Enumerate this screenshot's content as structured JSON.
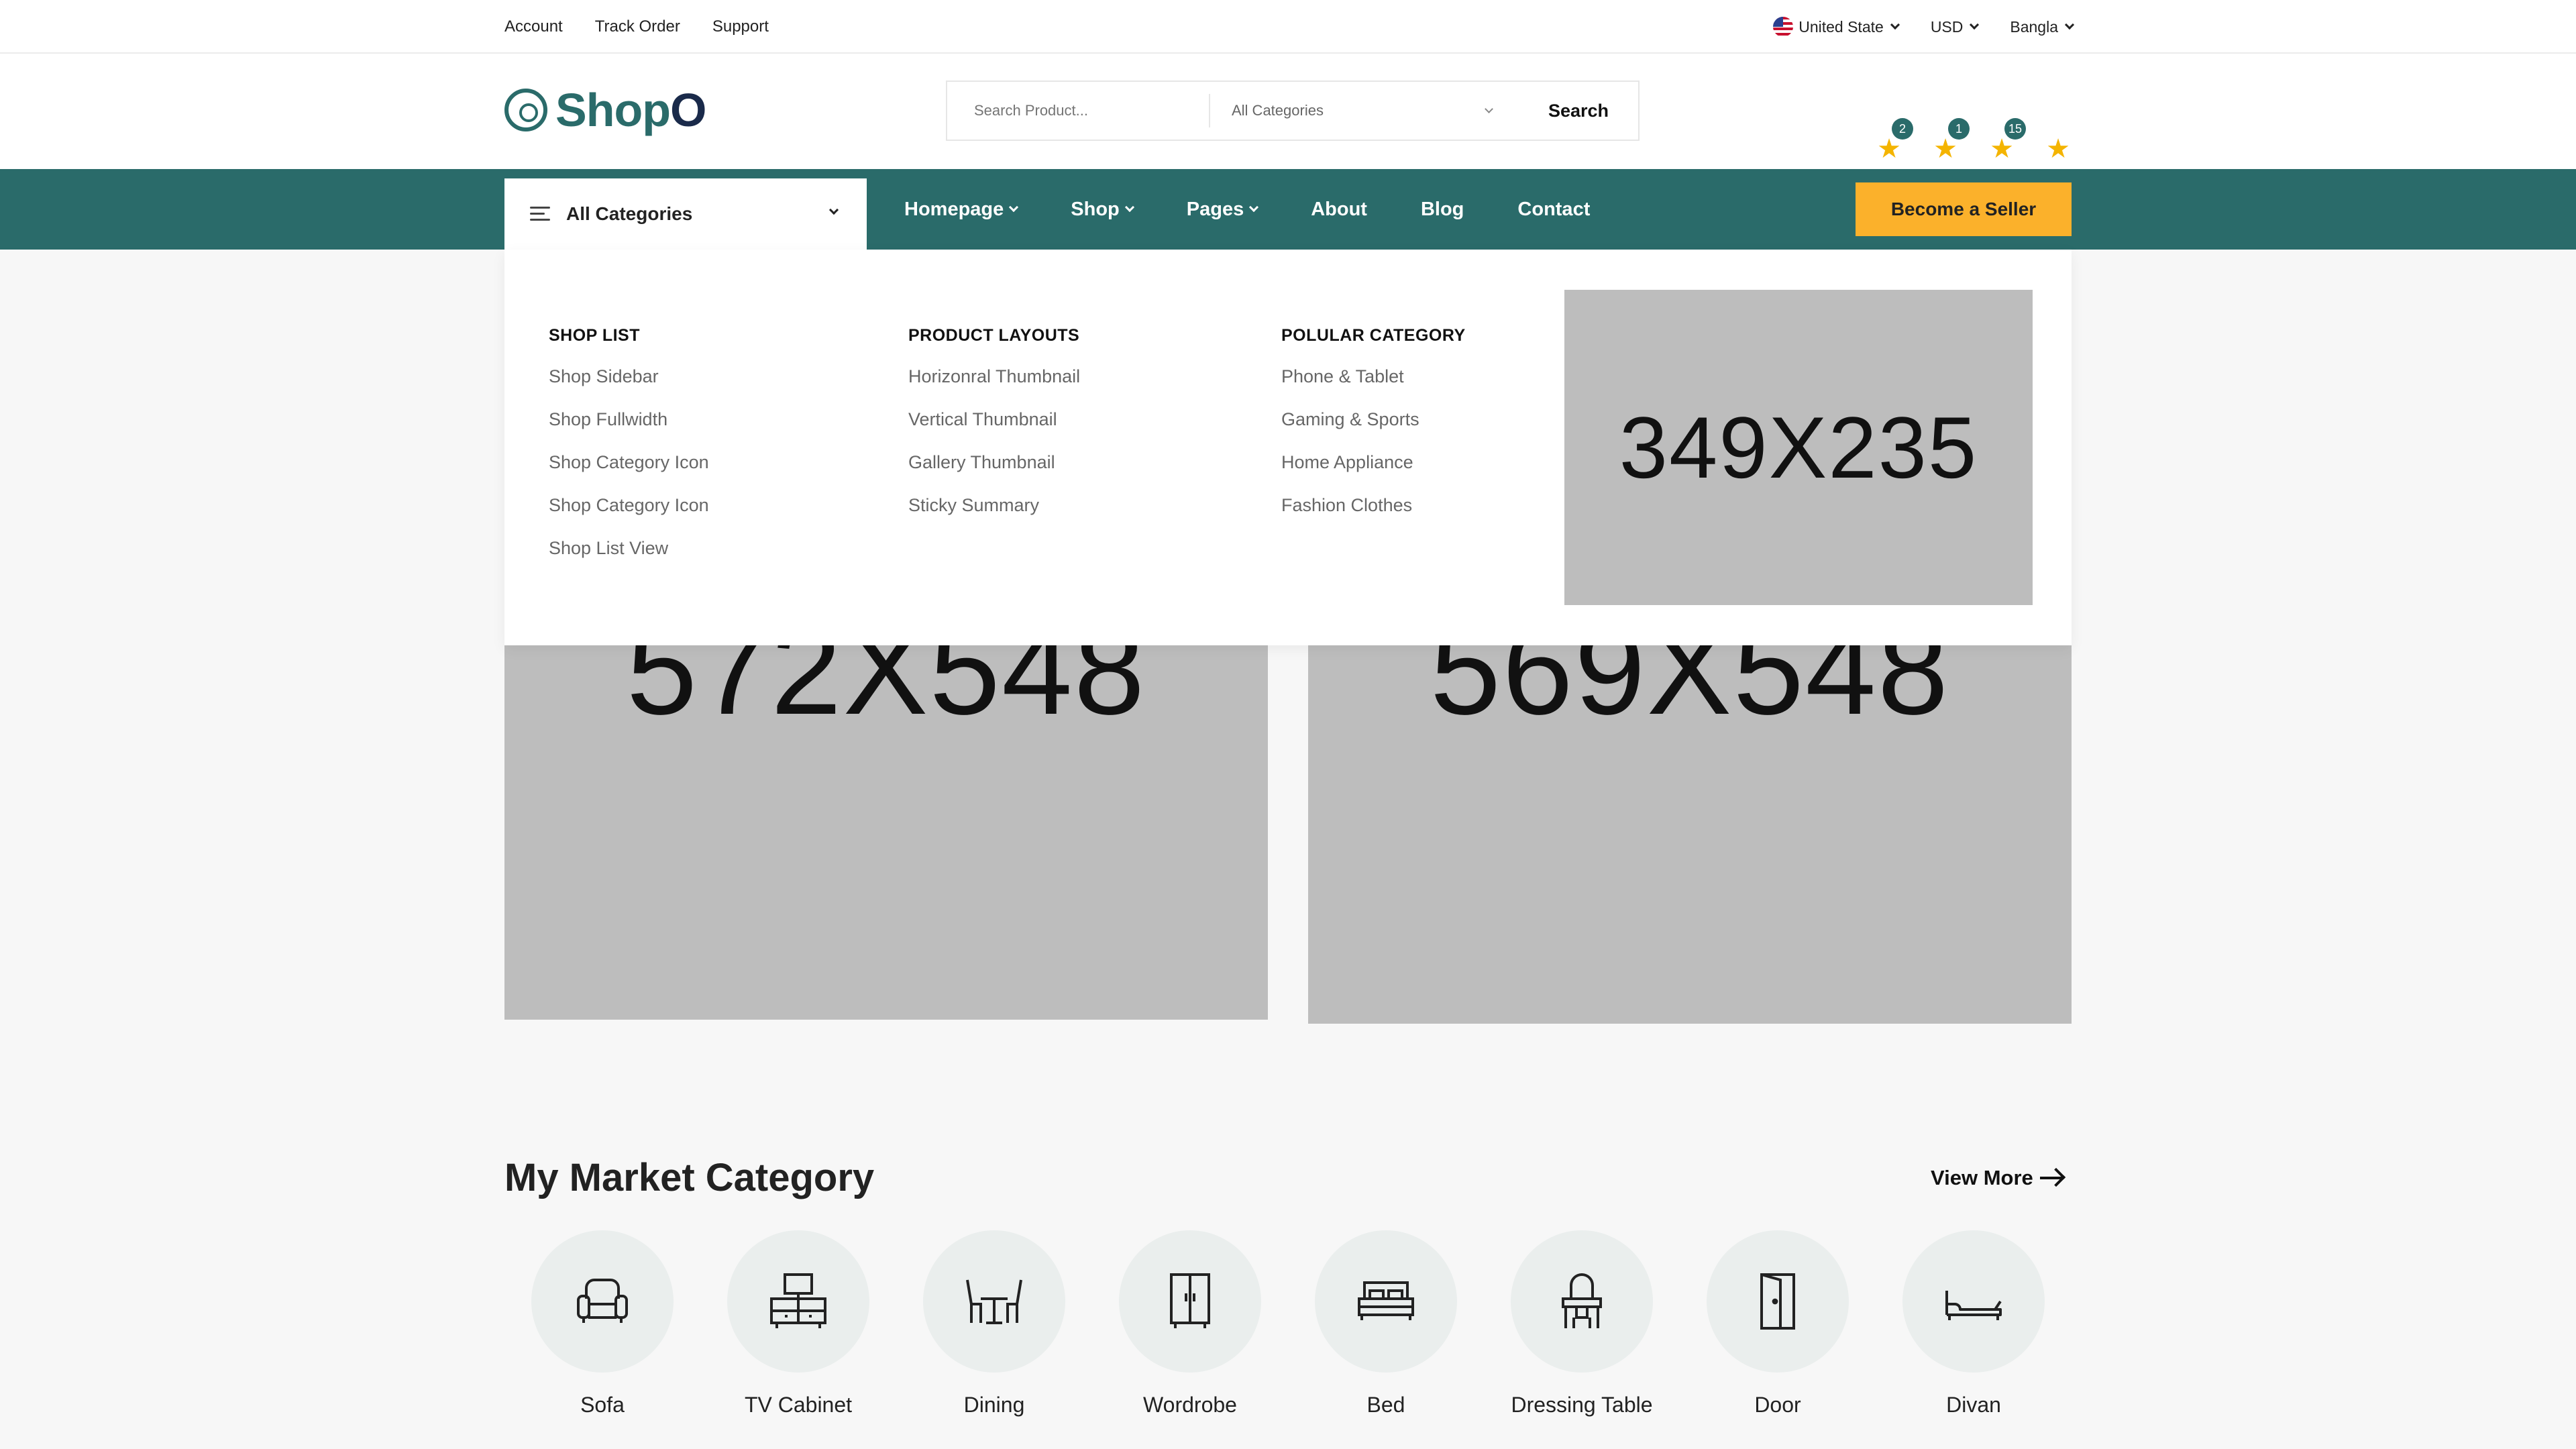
{
  "topbar": {
    "links": [
      "Account",
      "Track Order",
      "Support"
    ],
    "country": "United State",
    "currency": "USD",
    "language": "Bangla"
  },
  "logo": {
    "text": "Shop",
    "accent": "O"
  },
  "search": {
    "placeholder": "Search Product...",
    "category": "All Categories",
    "button": "Search"
  },
  "header_icons": [
    {
      "icon": "star-icon",
      "count": "2"
    },
    {
      "icon": "star-icon",
      "count": "1"
    },
    {
      "icon": "star-icon",
      "count": "15"
    },
    {
      "icon": "star-icon",
      "count": ""
    }
  ],
  "nav": {
    "all_categories": "All Categories",
    "items": [
      {
        "label": "Homepage",
        "dropdown": true
      },
      {
        "label": "Shop",
        "dropdown": true
      },
      {
        "label": "Pages",
        "dropdown": true
      },
      {
        "label": "About",
        "dropdown": false
      },
      {
        "label": "Blog",
        "dropdown": false
      },
      {
        "label": "Contact",
        "dropdown": false
      }
    ],
    "cta": "Become a Seller"
  },
  "mega_menu": {
    "columns": [
      {
        "title": "SHOP LIST",
        "items": [
          "Shop Sidebar",
          "Shop Fullwidth",
          "Shop Category Icon",
          "Shop Category Icon",
          "Shop List View"
        ]
      },
      {
        "title": "PRODUCT LAYOUTS",
        "items": [
          "Horizonral Thumbnail",
          "Vertical Thumbnail",
          "Gallery Thumbnail",
          "Sticky Summary"
        ]
      },
      {
        "title": "POLULAR CATEGORY",
        "items": [
          "Phone & Tablet",
          "Gaming & Sports",
          "Home Appliance",
          "Fashion Clothes"
        ]
      }
    ],
    "image_label": "349X235"
  },
  "hero": {
    "left_label": "572X548",
    "right_label": "569X548"
  },
  "categories": {
    "title": "My Market Category",
    "view_more": "View More",
    "items": [
      {
        "name": "Sofa",
        "icon": "sofa-icon"
      },
      {
        "name": "TV Cabinet",
        "icon": "tv-cabinet-icon"
      },
      {
        "name": "Dining",
        "icon": "dining-icon"
      },
      {
        "name": "Wordrobe",
        "icon": "wardrobe-icon"
      },
      {
        "name": "Bed",
        "icon": "bed-icon"
      },
      {
        "name": "Dressing Table",
        "icon": "dressing-table-icon"
      },
      {
        "name": "Door",
        "icon": "door-icon"
      },
      {
        "name": "Divan",
        "icon": "divan-icon"
      }
    ]
  },
  "colors": {
    "brand": "#2a6b6a",
    "accent": "#fbb12b",
    "placeholder": "#bdbdbd"
  }
}
